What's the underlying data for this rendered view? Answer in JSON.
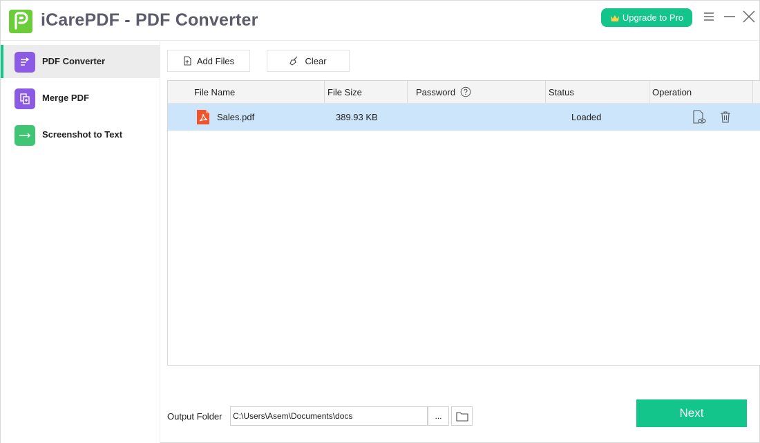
{
  "app": {
    "title": "iCarePDF - PDF Converter",
    "upgrade_label": "Upgrade to Pro",
    "logo_icon": "icarepdf-logo",
    "accent_color": "#13c58a"
  },
  "window_controls": [
    "menu-icon",
    "minimize-icon",
    "close-icon"
  ],
  "sidebar": {
    "items": [
      {
        "label": "PDF Converter",
        "icon": "convert-icon",
        "color": "#8c5be6",
        "active": true
      },
      {
        "label": "Merge PDF",
        "icon": "merge-icon",
        "color": "#8c5be6",
        "active": false
      },
      {
        "label": "Screenshot to Text",
        "icon": "arrow-right-icon",
        "color": "#3fc573",
        "active": false
      }
    ]
  },
  "toolbar": {
    "add_files_label": "Add Files",
    "clear_label": "Clear"
  },
  "table": {
    "columns": [
      "File Name",
      "File Size",
      "Password",
      "Status",
      "Operation"
    ],
    "rows": [
      {
        "file_name": "Sales.pdf",
        "file_size": "389.93 KB",
        "password": "",
        "status": "Loaded",
        "file_icon": "pdf-file-icon",
        "operations": [
          "preview-icon",
          "trash-icon"
        ]
      }
    ],
    "selected_row_color": "#cce5fb"
  },
  "footer": {
    "output_label": "Output Folder",
    "output_path": "C:\\Users\\Asem\\Documents\\docs",
    "browse_label": "...",
    "next_label": "Next"
  }
}
